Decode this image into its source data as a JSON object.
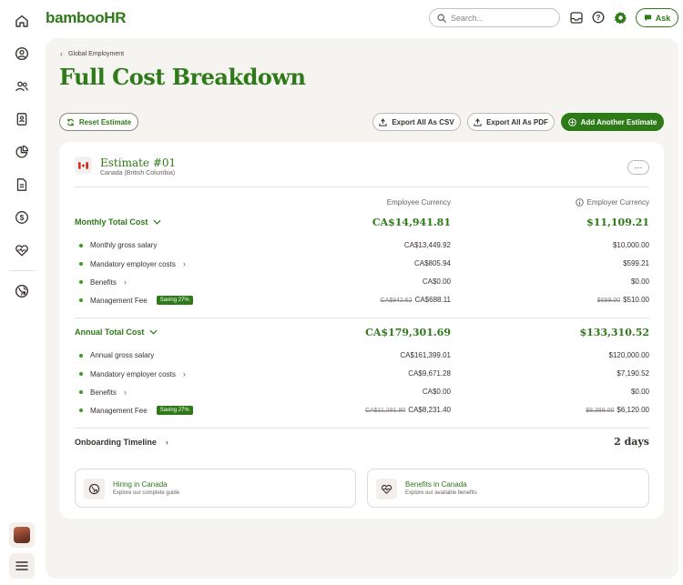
{
  "brand": {
    "logo_text": "bambooHR",
    "accent": "#2e7918"
  },
  "topbar": {
    "search_placeholder": "Search...",
    "ask_label": "Ask"
  },
  "rail": {
    "icons": [
      "home-icon",
      "profile-icon",
      "people-icon",
      "directory-icon",
      "reports-icon",
      "files-icon",
      "payroll-icon",
      "benefits-icon",
      "global-icon"
    ]
  },
  "breadcrumb": {
    "label": "Global Employment"
  },
  "page": {
    "title": "Full Cost Breakdown"
  },
  "actions": {
    "reset": "Reset Estimate",
    "export_csv": "Export All As CSV",
    "export_pdf": "Export All As PDF",
    "add_another": "Add Another Estimate"
  },
  "estimate": {
    "title": "Estimate #01",
    "location": "Canada (British Columbia)",
    "more": "···"
  },
  "columns": {
    "employee": "Employee Currency",
    "employer": "Employer Currency"
  },
  "monthly": {
    "title": "Monthly Total Cost",
    "employee_total": "CA$14,941.81",
    "employer_total": "$11,109.21",
    "rows": [
      {
        "label": "Monthly gross salary",
        "employee": "CA$13,449.92",
        "employer": "$10,000.00"
      },
      {
        "label": "Mandatory employer costs",
        "employee": "CA$805.94",
        "employer": "$599.21"
      },
      {
        "label": "Benefits",
        "employee": "CA$0.00",
        "employer": "$0.00"
      },
      {
        "label": "Management Fee",
        "badge": "Saving 27%",
        "employee_old": "CA$942.62",
        "employee": "CA$688.11",
        "employer_old": "$699.00",
        "employer": "$510.00"
      }
    ]
  },
  "annual": {
    "title": "Annual Total Cost",
    "employee_total": "CA$179,301.69",
    "employer_total": "$133,310.52",
    "rows": [
      {
        "label": "Annual gross salary",
        "employee": "CA$161,399.01",
        "employer": "$120,000.00"
      },
      {
        "label": "Mandatory employer costs",
        "employee": "CA$9,671.28",
        "employer": "$7,190.52"
      },
      {
        "label": "Benefits",
        "employee": "CA$0.00",
        "employer": "$0.00"
      },
      {
        "label": "Management Fee",
        "badge": "Saving 27%",
        "employee_old": "CA$11,281.80",
        "employee": "CA$8,231.40",
        "employer_old": "$8,388.00",
        "employer": "$6,120.00"
      }
    ]
  },
  "onboarding": {
    "label": "Onboarding Timeline",
    "value": "2 days"
  },
  "links": [
    {
      "title": "Hiring in Canada",
      "subtitle": "Explore our complete guide"
    },
    {
      "title": "Benefits in Canada",
      "subtitle": "Explore our available benefits"
    }
  ]
}
